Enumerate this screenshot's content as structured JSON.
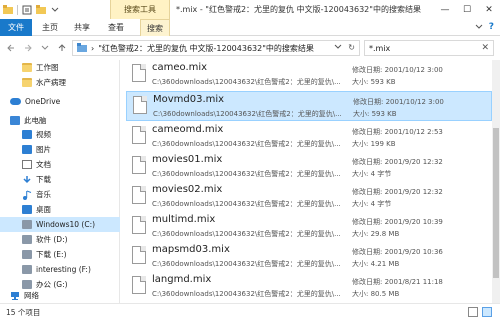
{
  "titlebar": {
    "context_tab": "搜索工具",
    "title": "*.mix - \"红色警戒2：尤里的复仇 中文版-120043632\"中的搜索结果",
    "minimize": "—",
    "maximize": "☐",
    "close": "✕"
  },
  "ribbon": {
    "tabs": [
      "文件",
      "主页",
      "共享",
      "查看",
      "搜索"
    ],
    "help": "?"
  },
  "address": {
    "path": "\"红色警戒2：尤里的复仇 中文版-120043632\"中的搜索结果",
    "chevron": "›",
    "refresh": "↻"
  },
  "search": {
    "value": "*.mix",
    "clear": "✕"
  },
  "nav": {
    "items": [
      {
        "label": "工作图",
        "icon": "folder-icon",
        "indent": 1
      },
      {
        "label": "水产病理",
        "icon": "folder-icon",
        "indent": 1
      },
      {
        "label": "OneDrive",
        "icon": "onedrive-icon",
        "indent": 0
      },
      {
        "label": "此电脑",
        "icon": "this-pc-icon",
        "indent": 0
      },
      {
        "label": "视频",
        "icon": "videos-icon",
        "indent": 1
      },
      {
        "label": "图片",
        "icon": "pictures-icon",
        "indent": 1
      },
      {
        "label": "文档",
        "icon": "documents-icon",
        "indent": 1
      },
      {
        "label": "下载",
        "icon": "downloads-icon",
        "indent": 1
      },
      {
        "label": "音乐",
        "icon": "music-icon",
        "indent": 1
      },
      {
        "label": "桌面",
        "icon": "desktop-icon",
        "indent": 1
      },
      {
        "label": "Windows10 (C:)",
        "icon": "drive-icon",
        "indent": 1,
        "selected": true
      },
      {
        "label": "软件 (D:)",
        "icon": "drive-icon",
        "indent": 1
      },
      {
        "label": "下载 (E:)",
        "icon": "drive-icon",
        "indent": 1
      },
      {
        "label": "interesting (F:)",
        "icon": "drive-icon",
        "indent": 1
      },
      {
        "label": "办公 (G:)",
        "icon": "drive-icon",
        "indent": 1
      },
      {
        "label": "网络",
        "icon": "network-icon",
        "indent": 0
      }
    ]
  },
  "files": [
    {
      "name": "cameo.mix",
      "path": "C:\\360downloads\\120043632\\红色警戒2：尤里的复仇\\...",
      "modified_label": "修改日期:",
      "modified": "2001/10/12 3:00",
      "size_label": "大小:",
      "size": "593 KB",
      "selected": false
    },
    {
      "name": "Movmd03.mix",
      "path": "C:\\360downloads\\120043632\\红色警戒2：尤里的复仇\\...",
      "modified_label": "修改日期:",
      "modified": "2001/10/12 3:00",
      "size_label": "大小:",
      "size": "593 KB",
      "selected": true
    },
    {
      "name": "cameomd.mix",
      "path": "C:\\360downloads\\120043632\\红色警戒2：尤里的复仇\\...",
      "modified_label": "修改日期:",
      "modified": "2001/10/12 2:53",
      "size_label": "大小:",
      "size": "199 KB",
      "selected": false
    },
    {
      "name": "movies01.mix",
      "path": "C:\\360downloads\\120043632\\红色警戒2：尤里的复仇\\...",
      "modified_label": "修改日期:",
      "modified": "2001/9/20 12:32",
      "size_label": "大小:",
      "size": "4 字节",
      "selected": false
    },
    {
      "name": "movies02.mix",
      "path": "C:\\360downloads\\120043632\\红色警戒2：尤里的复仇\\...",
      "modified_label": "修改日期:",
      "modified": "2001/9/20 12:32",
      "size_label": "大小:",
      "size": "4 字节",
      "selected": false
    },
    {
      "name": "multimd.mix",
      "path": "C:\\360downloads\\120043632\\红色警戒2：尤里的复仇\\...",
      "modified_label": "修改日期:",
      "modified": "2001/9/20 10:39",
      "size_label": "大小:",
      "size": "29.8 MB",
      "selected": false
    },
    {
      "name": "mapsmd03.mix",
      "path": "C:\\360downloads\\120043632\\红色警戒2：尤里的复仇\\...",
      "modified_label": "修改日期:",
      "modified": "2001/9/20 10:36",
      "size_label": "大小:",
      "size": "4.21 MB",
      "selected": false
    },
    {
      "name": "langmd.mix",
      "path": "C:\\360downloads\\120043632\\红色警戒2：尤里的复仇\\...",
      "modified_label": "修改日期:",
      "modified": "2001/8/21 11:18",
      "size_label": "大小:",
      "size": "80.5 MB",
      "selected": false
    }
  ],
  "status": {
    "count": "15 个项目"
  },
  "colors": {
    "accent": "#1979ca",
    "selection": "#cce8ff",
    "context_tab": "#fff2c4"
  }
}
